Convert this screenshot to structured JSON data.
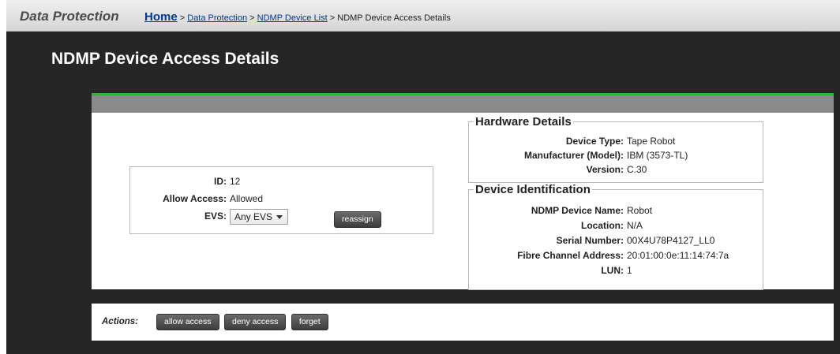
{
  "header": {
    "section_title": "Data Protection",
    "breadcrumb": [
      {
        "label": "Home",
        "link": true
      },
      {
        "label": "Data Protection",
        "link": true
      },
      {
        "label": "NDMP Device List",
        "link": true
      },
      {
        "label": "NDMP Device Access Details",
        "link": false
      }
    ],
    "separator": ">"
  },
  "page_title": "NDMP Device Access Details",
  "access": {
    "id_label": "ID:",
    "id_value": "12",
    "allow_label": "Allow Access:",
    "allow_value": "Allowed",
    "evs_label": "EVS:",
    "evs_value": "Any EVS",
    "reassign_label": "reassign"
  },
  "hardware": {
    "legend": "Hardware Details",
    "device_type_label": "Device Type:",
    "device_type_value": "Tape Robot",
    "manufacturer_label": "Manufacturer (Model):",
    "manufacturer_value": "IBM (3573-TL)",
    "version_label": "Version:",
    "version_value": "C.30"
  },
  "identification": {
    "legend": "Device Identification",
    "name_label": "NDMP Device Name:",
    "name_value": "Robot",
    "location_label": "Location:",
    "location_value": "N/A",
    "serial_label": "Serial Number:",
    "serial_value": "00X4U78P4127_LL0",
    "fca_label": "Fibre Channel Address:",
    "fca_value": "20:01:00:0e:11:14:74:7a",
    "lun_label": "LUN:",
    "lun_value": "1"
  },
  "actions": {
    "label": "Actions:",
    "allow_access": "allow access",
    "deny_access": "deny access",
    "forget": "forget"
  }
}
